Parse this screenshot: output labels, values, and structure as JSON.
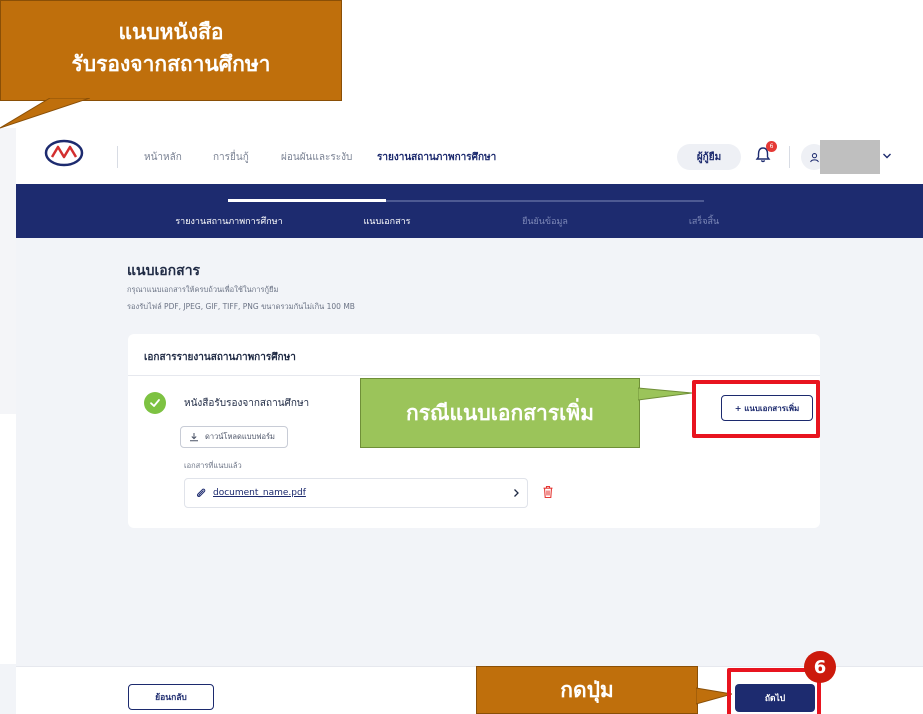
{
  "annotations": {
    "top_callout_line1": "แนบหนังสือ",
    "top_callout_line2": "รับรองจากสถานศึกษา",
    "add_callout": "กรณีแนบเอกสารเพิ่ม",
    "next_callout": "กดปุ่ม",
    "step_number": "6"
  },
  "nav": {
    "items": [
      {
        "label": "หน้าหลัก",
        "active": false
      },
      {
        "label": "การยื่นกู้",
        "active": false
      },
      {
        "label": "ผ่อนผันและระงับ",
        "active": false
      },
      {
        "label": "รายงานสถานภาพการศึกษา",
        "active": true
      }
    ],
    "role": "ผู้กู้ยืม",
    "notification_count": "6",
    "icons": {
      "logo": "kyf-logo",
      "bell": "bell-icon",
      "user": "user-icon",
      "chevron": "chevron-down-icon"
    }
  },
  "stepper": {
    "steps": [
      {
        "label": "รายงานสถานภาพการศึกษา",
        "state": "done"
      },
      {
        "label": "แนบเอกสาร",
        "state": "current"
      },
      {
        "label": "ยืนยันข้อมูล",
        "state": "pending"
      },
      {
        "label": "เสร็จสิ้น",
        "state": "pending"
      }
    ]
  },
  "page": {
    "title": "แนบเอกสาร",
    "description": "กรุณาแนบเอกสารให้ครบถ้วนเพื่อใช้ในการกู้ยืม",
    "file_rules": "รองรับไฟล์ PDF, JPEG, GIF, TIFF, PNG ขนาดรวมกันไม่เกิน 100 MB"
  },
  "card": {
    "title": "เอกสารรายงานสถานภาพการศึกษา",
    "document_name": "หนังสือรับรองจากสถานศึกษา",
    "download_label": "ดาวน์โหลดแบบฟอร์ม",
    "add_label": "+ แนบเอกสารเพิ่ม",
    "attached_label": "เอกสารที่แนบแล้ว",
    "file_name": "document_name.pdf"
  },
  "footer": {
    "back_label": "ย้อนกลับ",
    "next_label": "ถัดไป"
  },
  "colors": {
    "primary": "#1d2b6f",
    "success": "#7dc242",
    "danger": "#e53935",
    "callout_orange": "#bf6f0c",
    "callout_green": "#9bc45a",
    "highlight_red": "#e8141f"
  }
}
